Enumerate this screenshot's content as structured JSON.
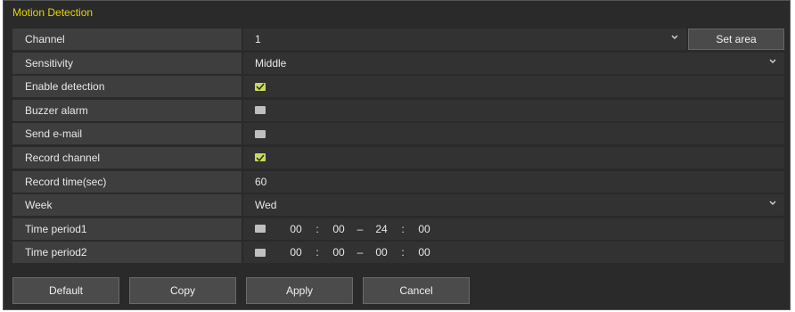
{
  "panel": {
    "title": "Motion Detection"
  },
  "fields": {
    "channel": {
      "label": "Channel",
      "value": "1",
      "set_area_label": "Set area"
    },
    "sensitivity": {
      "label": "Sensitivity",
      "value": "Middle"
    },
    "enable_detection": {
      "label": "Enable detection",
      "checked": true
    },
    "buzzer_alarm": {
      "label": "Buzzer alarm",
      "checked": false
    },
    "send_email": {
      "label": "Send e-mail",
      "checked": false
    },
    "record_channel": {
      "label": "Record channel",
      "checked": true
    },
    "record_time": {
      "label": "Record time(sec)",
      "value": "60"
    },
    "week": {
      "label": "Week",
      "value": "Wed"
    },
    "time_period1": {
      "label": "Time period1",
      "checked": false,
      "start_h": "00",
      "start_m": "00",
      "end_h": "24",
      "end_m": "00"
    },
    "time_period2": {
      "label": "Time period2",
      "checked": false,
      "start_h": "00",
      "start_m": "00",
      "end_h": "00",
      "end_m": "00"
    }
  },
  "symbols": {
    "colon": ":",
    "dash": "–"
  },
  "buttons": {
    "default": "Default",
    "copy": "Copy",
    "apply": "Apply",
    "cancel": "Cancel"
  },
  "colors": {
    "title": "#e6d400",
    "checked": "#c9d95a",
    "unchecked": "#bfbfbf"
  }
}
